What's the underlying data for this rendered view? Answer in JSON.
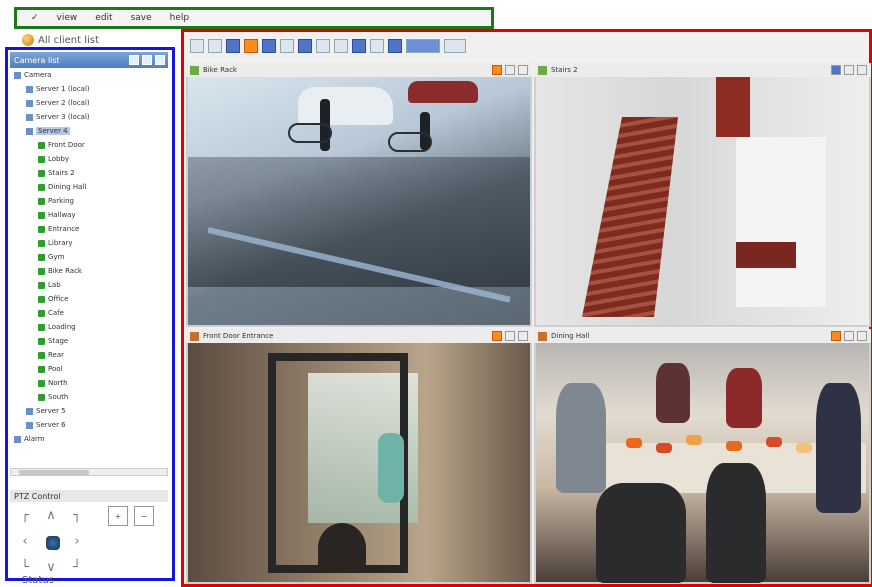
{
  "menu": {
    "items": [
      "✓",
      "view",
      "edit",
      "save",
      "help"
    ]
  },
  "app": {
    "title": "All client list"
  },
  "left_panel": {
    "header": "Camera list",
    "tree": [
      {
        "label": "Camera",
        "depth": 0,
        "type": "server"
      },
      {
        "label": "Server 1 (local)",
        "depth": 1,
        "type": "server"
      },
      {
        "label": "Server 2 (local)",
        "depth": 1,
        "type": "server"
      },
      {
        "label": "Server 3 (local)",
        "depth": 1,
        "type": "server"
      },
      {
        "label": "Server 4",
        "depth": 1,
        "type": "server",
        "selected": true
      },
      {
        "label": "Front Door",
        "depth": 2,
        "type": "camera"
      },
      {
        "label": "Lobby",
        "depth": 2,
        "type": "camera"
      },
      {
        "label": "Stairs 2",
        "depth": 2,
        "type": "camera"
      },
      {
        "label": "Dining Hall",
        "depth": 2,
        "type": "camera"
      },
      {
        "label": "Parking",
        "depth": 2,
        "type": "camera"
      },
      {
        "label": "Hallway",
        "depth": 2,
        "type": "camera"
      },
      {
        "label": "Entrance",
        "depth": 2,
        "type": "camera"
      },
      {
        "label": "Library",
        "depth": 2,
        "type": "camera"
      },
      {
        "label": "Gym",
        "depth": 2,
        "type": "camera"
      },
      {
        "label": "Bike Rack",
        "depth": 2,
        "type": "camera"
      },
      {
        "label": "Lab",
        "depth": 2,
        "type": "camera"
      },
      {
        "label": "Office",
        "depth": 2,
        "type": "camera"
      },
      {
        "label": "Cafe",
        "depth": 2,
        "type": "camera"
      },
      {
        "label": "Loading",
        "depth": 2,
        "type": "camera"
      },
      {
        "label": "Stage",
        "depth": 2,
        "type": "camera"
      },
      {
        "label": "Rear",
        "depth": 2,
        "type": "camera"
      },
      {
        "label": "Pool",
        "depth": 2,
        "type": "camera"
      },
      {
        "label": "North",
        "depth": 2,
        "type": "camera"
      },
      {
        "label": "South",
        "depth": 2,
        "type": "camera"
      },
      {
        "label": "Server 5",
        "depth": 1,
        "type": "server"
      },
      {
        "label": "Server 6",
        "depth": 1,
        "type": "server"
      },
      {
        "label": "Alarm",
        "depth": 0,
        "type": "server"
      }
    ],
    "ptz_header": "PTZ Control",
    "zoom_in": "+",
    "zoom_out": "−"
  },
  "bottom": {
    "label": "Status"
  },
  "tiles": [
    {
      "title": "Bike Rack"
    },
    {
      "title": "Stairs 2"
    },
    {
      "title": "Front Door Entrance"
    },
    {
      "title": "Dining Hall"
    }
  ]
}
